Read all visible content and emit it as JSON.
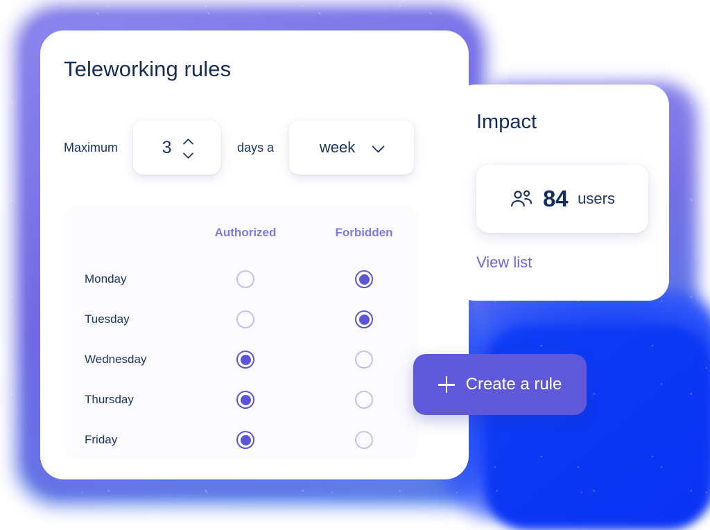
{
  "theme": {
    "accent_purple": "#5B54D6",
    "accent_button": "#5F58D8",
    "link_purple": "#6B66DB",
    "column_header_purple": "#7D79E8",
    "text_navy": "#1E3461",
    "title_navy": "#152D5B",
    "radio_off_border": "#C3C0EE",
    "glow_blue": "#0F3EF6",
    "card_white": "#FFFFFF",
    "panel_off_white": "#FBFBFE"
  },
  "main_card": {
    "title": "Teleworking rules",
    "rule": {
      "label": "Maximum",
      "stepper": {
        "value": "3",
        "increment_icon": "chevron-up-icon",
        "decrement_icon": "chevron-down-icon"
      },
      "middle_label": "days a",
      "period_select": {
        "value": "week",
        "chevron_icon": "chevron-down-icon"
      }
    },
    "days_panel": {
      "columns": [
        "Authorized",
        "Forbidden"
      ],
      "rows": [
        {
          "day": "Monday",
          "authorized": false,
          "forbidden": true
        },
        {
          "day": "Tuesday",
          "authorized": false,
          "forbidden": true
        },
        {
          "day": "Wednesday",
          "authorized": true,
          "forbidden": false
        },
        {
          "day": "Thursday",
          "authorized": true,
          "forbidden": false
        },
        {
          "day": "Friday",
          "authorized": true,
          "forbidden": false
        }
      ]
    }
  },
  "impact_card": {
    "title": "Impact",
    "stat": {
      "icon": "users-icon",
      "number": "84",
      "unit": "users"
    },
    "view_list_link": "View list"
  },
  "create_button": {
    "icon": "plus-icon",
    "label": "Create a rule"
  }
}
